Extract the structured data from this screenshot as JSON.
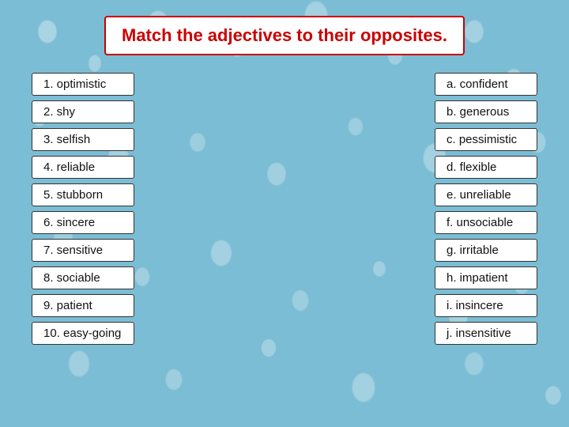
{
  "title": "Match the adjectives to their opposites.",
  "left_items": [
    "1. optimistic",
    "2. shy",
    "3. selfish",
    "4. reliable",
    "5. stubborn",
    "6. sincere",
    "7. sensitive",
    "8. sociable",
    "9. patient",
    "10. easy-going"
  ],
  "right_items": [
    "a. confident",
    "b. generous",
    "c. pessimistic",
    "d. flexible",
    "e. unreliable",
    "f. unsociable",
    "g. irritable",
    "h. impatient",
    "i. insincere",
    "j. insensitive"
  ]
}
